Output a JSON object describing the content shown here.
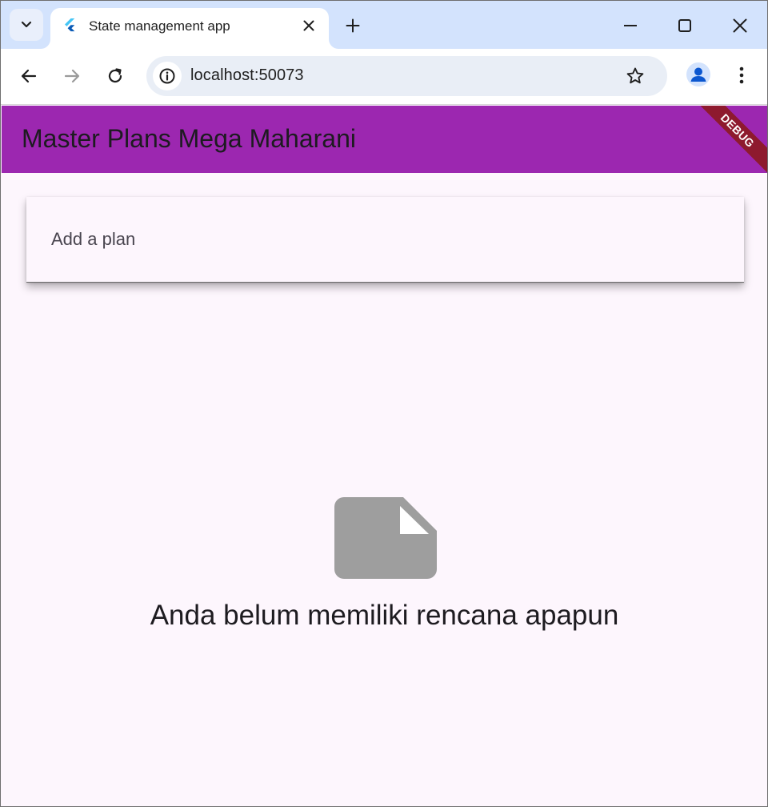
{
  "browser": {
    "tab": {
      "title": "State management app"
    },
    "address_bar": {
      "url": "localhost:50073"
    }
  },
  "app": {
    "title": "Master Plans Mega Maharani",
    "debug_banner": "DEBUG",
    "plan_input": {
      "placeholder": "Add a plan",
      "value": ""
    },
    "empty_state": {
      "icon": "note-icon",
      "message": "Anda belum memiliki rencana apapun"
    }
  },
  "colors": {
    "tabstrip": "#d3e3fd",
    "appbar": "#9c27b0",
    "background": "#fdf6fd",
    "empty_icon": "#9e9e9e",
    "debug_banner": "#8e1a2e"
  }
}
